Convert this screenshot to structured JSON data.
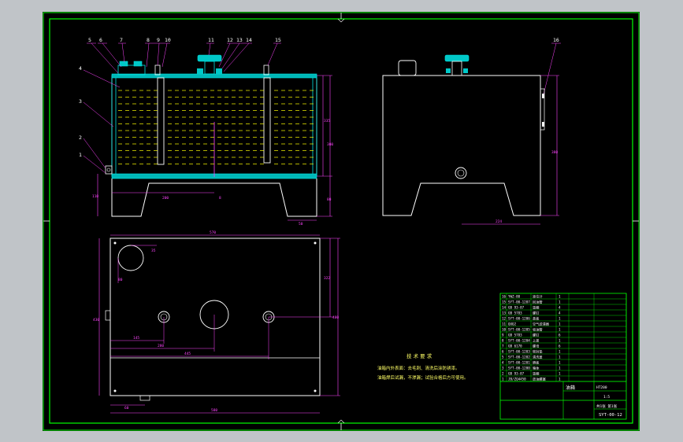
{
  "colors": {
    "background": "#c0c4c8",
    "sheet": "#000000",
    "outline": "#ffffff",
    "border": "#00ff00",
    "dimension": "#ff44ff",
    "oil_dash": "#ffff00",
    "cover_teal": "#00e0e0",
    "label_text": "#ffffff"
  },
  "part_numbers": [
    "5",
    "6",
    "7",
    "8",
    "9",
    "10",
    "11",
    "12",
    "13",
    "14",
    "15",
    "16",
    "4",
    "3",
    "2",
    "1"
  ],
  "front_view": {
    "dim_200": "200",
    "dim_8": "8",
    "dim_vertical_a": "335",
    "dim_vertical_b": "300",
    "dim_vertical_c": "80",
    "dim_left": "110",
    "dim_bottom_right": "50"
  },
  "side_view": {
    "dim_height": "380",
    "dim_bottom": "224"
  },
  "top_view": {
    "dim_top": "570",
    "dim_circle_r": "35",
    "dim_circle_off": "80",
    "dim_right_a": "322",
    "dim_right_b": "400",
    "dim_left": "430",
    "dim_145": "145",
    "dim_280": "280",
    "dim_445": "445",
    "dim_bottom_left": "60",
    "dim_bottom": "580"
  },
  "tech_requirements": {
    "title": "技 术 要 求",
    "line1": "油箱内外表面：去毛刺、清洗后涂防锈漆。",
    "line2": "油箱焊后试漏，不渗漏；试验合格后方可使用。"
  },
  "title_block": {
    "drawing_name": "油箱",
    "material": "HT200",
    "scale": "1:5",
    "drawing_number": "SYT-00-12",
    "sheet_info": "共1张 第1张",
    "rows": [
      {
        "no": "16",
        "code": "YWZ-80",
        "name": "液位计",
        "qty": "1"
      },
      {
        "no": "15",
        "code": "SYT-00-1207",
        "name": "回油管",
        "qty": "1"
      },
      {
        "no": "14",
        "code": "GB 93-87",
        "name": "垫圈",
        "qty": "4"
      },
      {
        "no": "13",
        "code": "GB 5783",
        "name": "螺钉",
        "qty": "4"
      },
      {
        "no": "12",
        "code": "SYT-00-1206",
        "name": "盖板",
        "qty": "1"
      },
      {
        "no": "11",
        "code": "QUQ2",
        "name": "空气滤清器",
        "qty": "1"
      },
      {
        "no": "10",
        "code": "SYT-00-1205",
        "name": "吸油管",
        "qty": "1"
      },
      {
        "no": "9",
        "code": "GB 5783",
        "name": "螺钉",
        "qty": "6"
      },
      {
        "no": "8",
        "code": "SYT-00-1204",
        "name": "上盖",
        "qty": "1"
      },
      {
        "no": "7",
        "code": "GB 6170",
        "name": "螺母",
        "qty": "6"
      },
      {
        "no": "6",
        "code": "SYT-00-1203",
        "name": "密封垫",
        "qty": "1"
      },
      {
        "no": "5",
        "code": "SYT-00-1202",
        "name": "清洗盖",
        "qty": "1"
      },
      {
        "no": "4",
        "code": "SYT-00-1201",
        "name": "隔板",
        "qty": "1"
      },
      {
        "no": "3",
        "code": "SYT-00-1200",
        "name": "箱体",
        "qty": "1"
      },
      {
        "no": "2",
        "code": "GB 93-87",
        "name": "垫圈",
        "qty": "1"
      },
      {
        "no": "1",
        "code": "JB/ZQ4450",
        "name": "放油螺塞",
        "qty": "1"
      }
    ]
  }
}
